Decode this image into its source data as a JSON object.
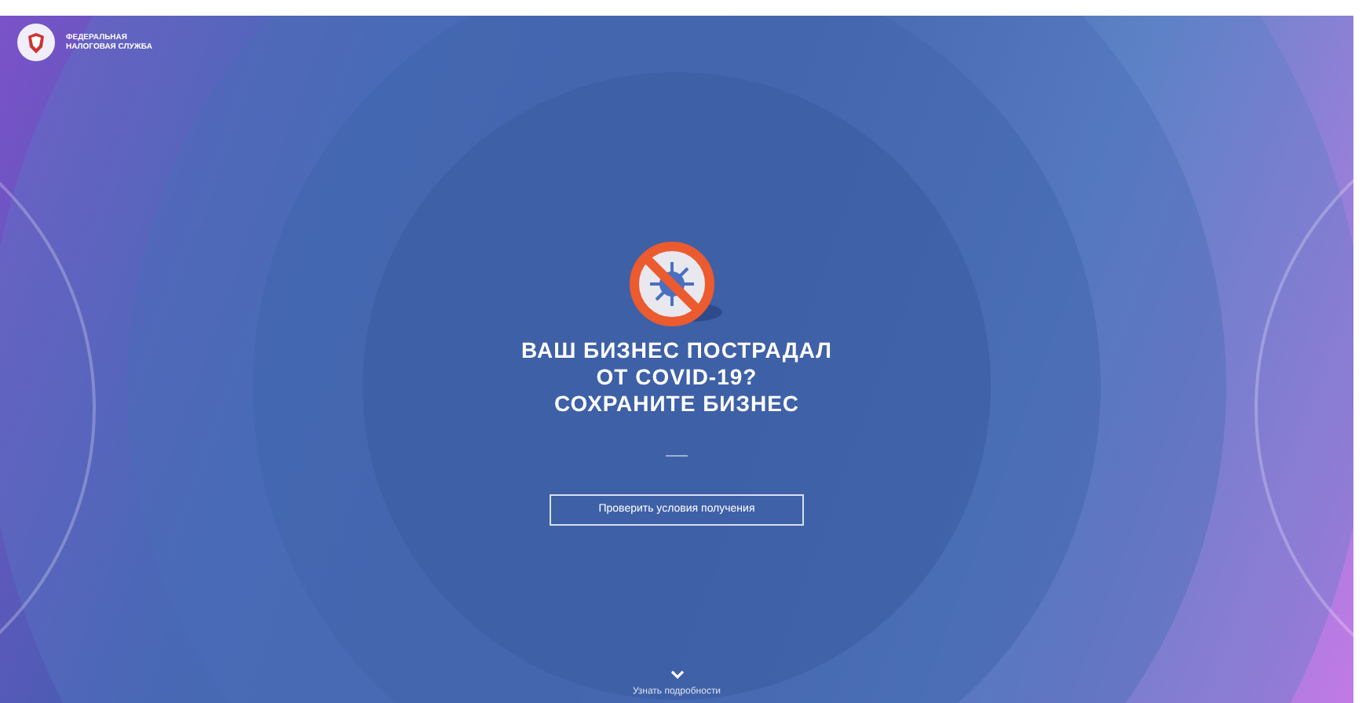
{
  "header": {
    "logo_text": [
      "ФЕДЕРАЛЬНАЯ",
      "НАЛОГОВАЯ СЛУЖБА"
    ]
  },
  "hero": {
    "headline": [
      "ВАШ БИЗНЕС ПОСТРАДАЛ",
      "ОТ COVID-19?",
      "СОХРАНИТЕ БИЗНЕС"
    ],
    "button": "Проверить условия получения"
  },
  "footer": {
    "more_link": "Узнать подробности"
  }
}
